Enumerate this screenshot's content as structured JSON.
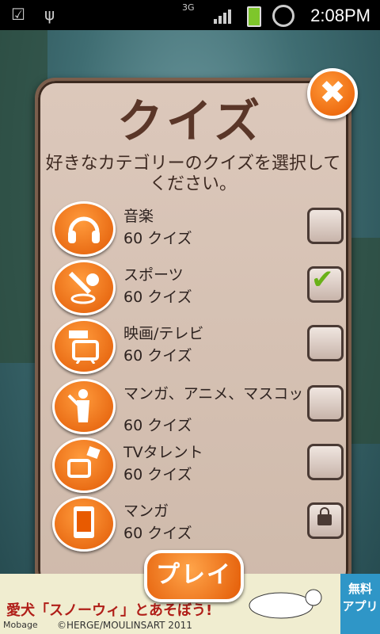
{
  "status": {
    "time": "2:08PM",
    "network": "3G"
  },
  "dialog": {
    "title": "クイズ",
    "subtitle": "好きなカテゴリーのクイズを選択してください。",
    "close_label": "✖",
    "play_label": "プレイ",
    "categories": [
      {
        "name": "音楽",
        "count": "60 クイズ",
        "icon": "headphones-icon",
        "state": "unchecked"
      },
      {
        "name": "スポーツ",
        "count": "60 クイズ",
        "icon": "sports-icon",
        "state": "checked"
      },
      {
        "name": "映画/テレビ",
        "count": "60 クイズ",
        "icon": "movie-tv-icon",
        "state": "unchecked"
      },
      {
        "name": "マンガ、アニメ、マスコット",
        "count": "60 クイズ",
        "icon": "silhouette-icon",
        "state": "unchecked"
      },
      {
        "name": "TVタレント",
        "count": "60 クイズ",
        "icon": "tv-talent-icon",
        "state": "unchecked"
      },
      {
        "name": "マンガ",
        "count": "60 クイズ",
        "icon": "manga-book-icon",
        "state": "locked"
      }
    ]
  },
  "ad": {
    "headline": "愛犬「スノーウィ」とあそぼう!",
    "brand": "Mobage",
    "credit": "©HERGE/MOULINSART 2011",
    "badge_line1": "無料",
    "badge_line2": "アプリ"
  },
  "colors": {
    "accent": "#e85a00",
    "panel": "#d6c2b4",
    "check": "#69b118"
  }
}
